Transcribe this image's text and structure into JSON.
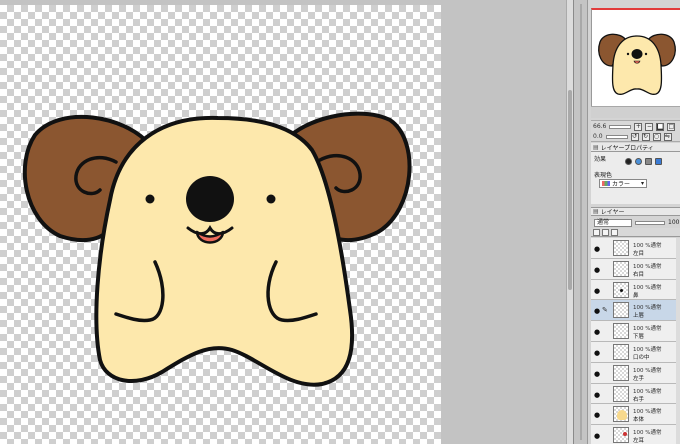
{
  "canvas": {
    "character": {
      "body_color": "#fde8ac",
      "horn_color": "#8b5630",
      "outline_color": "#111111",
      "tongue_color": "#ee6b5b"
    }
  },
  "navigator": {
    "accent_color": "#e23b3b"
  },
  "nav_toolbar": {
    "zoom_label": "66.6",
    "angle_label": "0.0",
    "buttons": [
      "zoom-in-icon",
      "zoom-out-icon",
      "fit-icon",
      "rotate-icon",
      "flip-icon"
    ]
  },
  "layer_property": {
    "tab_label": "レイヤープロパティ",
    "effect_label": "効果",
    "expression_label": "表現色",
    "color_value": "カラー"
  },
  "layers_panel": {
    "tab_label": "レイヤー",
    "blend_mode": "通常",
    "opacity": "100",
    "items": [
      {
        "mode": "100 %通常",
        "name": "左目",
        "thumb": "blank",
        "active": false,
        "pen": false
      },
      {
        "mode": "100 %通常",
        "name": "右目",
        "thumb": "blank",
        "active": false,
        "pen": false
      },
      {
        "mode": "100 %通常",
        "name": "鼻",
        "thumb": "dot",
        "active": false,
        "pen": false
      },
      {
        "mode": "100 %通常",
        "name": "上唇",
        "thumb": "blank",
        "active": true,
        "pen": true
      },
      {
        "mode": "100 %通常",
        "name": "下唇",
        "thumb": "blank",
        "active": false,
        "pen": false
      },
      {
        "mode": "100 %通常",
        "name": "口の中",
        "thumb": "blank",
        "active": false,
        "pen": false
      },
      {
        "mode": "100 %通常",
        "name": "左手",
        "thumb": "blank",
        "active": false,
        "pen": false
      },
      {
        "mode": "100 %通常",
        "name": "右手",
        "thumb": "blank",
        "active": false,
        "pen": false
      },
      {
        "mode": "100 %通常",
        "name": "本体",
        "thumb": "blob",
        "active": false,
        "pen": false
      },
      {
        "mode": "100 %通常",
        "name": "左耳",
        "thumb": "red",
        "active": false,
        "pen": false
      }
    ]
  }
}
